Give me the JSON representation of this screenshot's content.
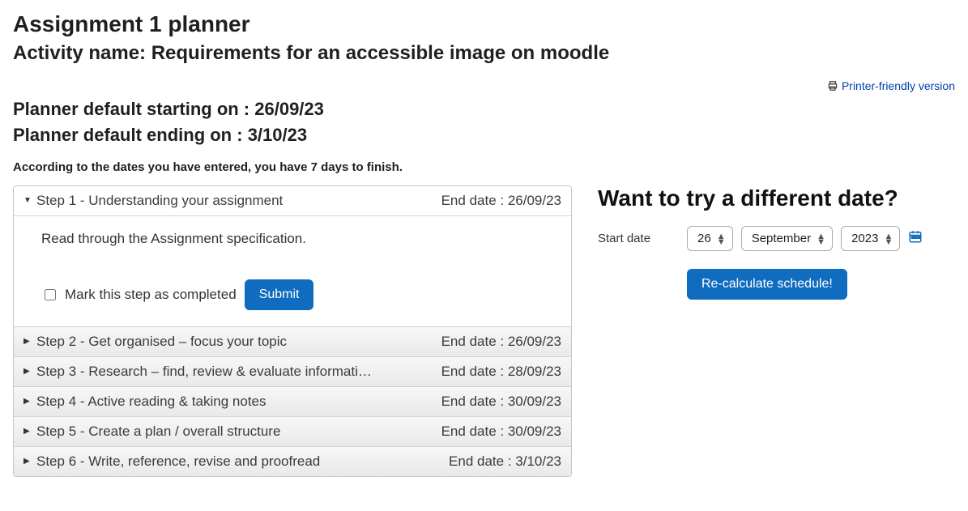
{
  "header": {
    "title": "Assignment 1 planner",
    "activity_prefix": "Activity name: ",
    "activity_name": "Requirements for an accessible image on moodle",
    "printer_link": "Printer-friendly version",
    "start_line_prefix": "Planner default starting on : ",
    "start_date": "26/09/23",
    "end_line_prefix": "Planner default ending on : ",
    "end_date": "3/10/23",
    "summary": "According to the dates you have entered, you have 7 days to finish."
  },
  "steps": [
    {
      "title": "Step 1 - Understanding your assignment",
      "end_label": "End date : 26/09/23",
      "expanded": true,
      "body": "Read through the Assignment specification.",
      "mark_label": "Mark this step as completed",
      "submit_label": "Submit"
    },
    {
      "title": "Step 2 - Get organised – focus your topic",
      "end_label": "End date : 26/09/23"
    },
    {
      "title": "Step 3 - Research – find, review & evaluate informati…",
      "end_label": "End date : 28/09/23"
    },
    {
      "title": "Step 4 - Active reading & taking notes",
      "end_label": "End date : 30/09/23"
    },
    {
      "title": "Step 5 - Create a plan / overall structure",
      "end_label": "End date : 30/09/23"
    },
    {
      "title": "Step 6 - Write, reference, revise and proofread",
      "end_label": "End date : 3/10/23"
    }
  ],
  "sidebar": {
    "heading": "Want to try a different date?",
    "start_date_label": "Start date",
    "day": "26",
    "month": "September",
    "year": "2023",
    "recalc_label": "Re-calculate schedule!"
  }
}
